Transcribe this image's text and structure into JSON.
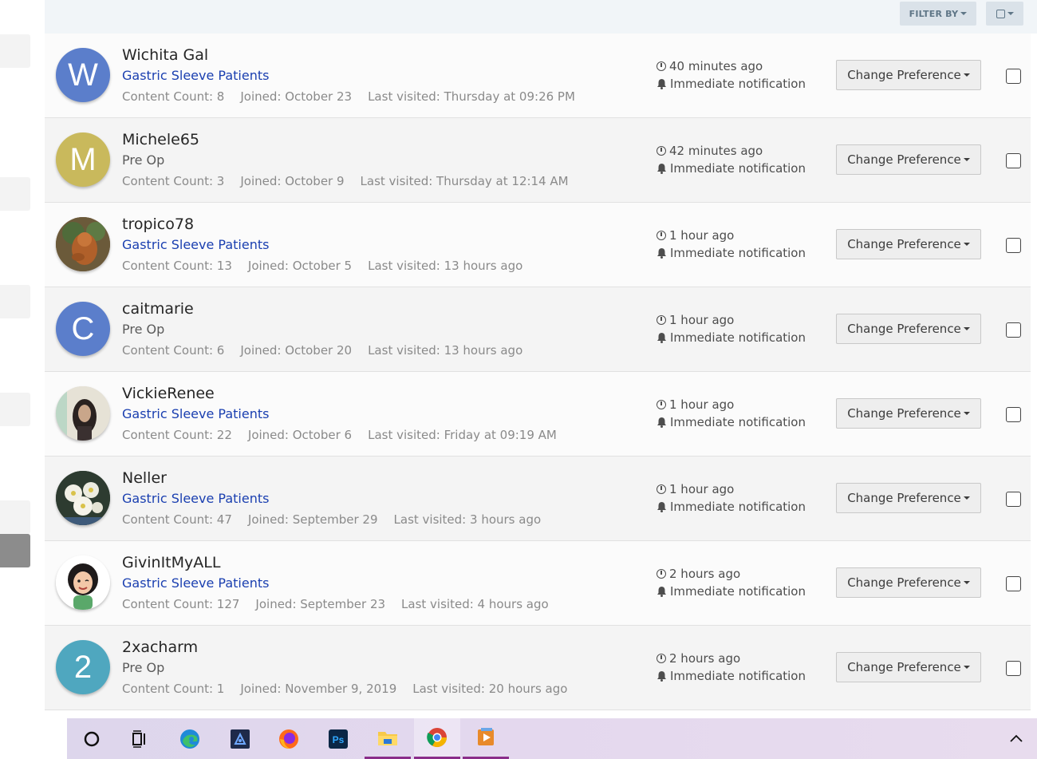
{
  "toolbar": {
    "filter_label": "FILTER BY"
  },
  "members": [
    {
      "name": "Wichita Gal",
      "group": "Gastric Sleeve Patients",
      "group_type": "link",
      "content_count": "Content Count: 8",
      "joined": "Joined: October 23",
      "last_visited": "Last visited: Thursday at 09:26 PM",
      "time": "40 minutes ago",
      "notification": "Immediate notification",
      "pref_label": "Change Preference",
      "avatar_letter": "W",
      "avatar_color": "#5b7ecb"
    },
    {
      "name": "Michele65",
      "group": "Pre Op",
      "group_type": "plain",
      "content_count": "Content Count: 3",
      "joined": "Joined: October 9",
      "last_visited": "Last visited: Thursday at 12:14 AM",
      "time": "42 minutes ago",
      "notification": "Immediate notification",
      "pref_label": "Change Preference",
      "avatar_letter": "M",
      "avatar_color": "#c9b95c"
    },
    {
      "name": "tropico78",
      "group": "Gastric Sleeve Patients",
      "group_type": "link",
      "content_count": "Content Count: 13",
      "joined": "Joined: October 5",
      "last_visited": "Last visited: 13 hours ago",
      "time": "1 hour ago",
      "notification": "Immediate notification",
      "pref_label": "Change Preference",
      "avatar_letter": "",
      "avatar_color": "#7a5a3a"
    },
    {
      "name": "caitmarie",
      "group": "Pre Op",
      "group_type": "plain",
      "content_count": "Content Count: 6",
      "joined": "Joined: October 20",
      "last_visited": "Last visited: 13 hours ago",
      "time": "1 hour ago",
      "notification": "Immediate notification",
      "pref_label": "Change Preference",
      "avatar_letter": "C",
      "avatar_color": "#5b7ecb"
    },
    {
      "name": "VickieRenee",
      "group": "Gastric Sleeve Patients",
      "group_type": "link",
      "content_count": "Content Count: 22",
      "joined": "Joined: October 6",
      "last_visited": "Last visited: Friday at 09:19 AM",
      "time": "1 hour ago",
      "notification": "Immediate notification",
      "pref_label": "Change Preference",
      "avatar_letter": "",
      "avatar_color": "#d9d4c8"
    },
    {
      "name": "Neller",
      "group": "Gastric Sleeve Patients",
      "group_type": "link",
      "content_count": "Content Count: 47",
      "joined": "Joined: September 29",
      "last_visited": "Last visited: 3 hours ago",
      "time": "1 hour ago",
      "notification": "Immediate notification",
      "pref_label": "Change Preference",
      "avatar_letter": "",
      "avatar_color": "#3c4a3c"
    },
    {
      "name": "GivinItMyALL",
      "group": "Gastric Sleeve Patients",
      "group_type": "link",
      "content_count": "Content Count: 127",
      "joined": "Joined: September 23",
      "last_visited": "Last visited: 4 hours ago",
      "time": "2 hours ago",
      "notification": "Immediate notification",
      "pref_label": "Change Preference",
      "avatar_letter": "",
      "avatar_color": "#ffffff"
    },
    {
      "name": "2xacharm",
      "group": "Pre Op",
      "group_type": "plain",
      "content_count": "Content Count: 1",
      "joined": "Joined: November 9, 2019",
      "last_visited": "Last visited: 20 hours ago",
      "time": "2 hours ago",
      "notification": "Immediate notification",
      "pref_label": "Change Preference",
      "avatar_letter": "2",
      "avatar_color": "#4fa7bf"
    }
  ],
  "taskbar": {
    "apps": [
      "search-circle",
      "task-view",
      "edge",
      "app-dark",
      "firefox",
      "photoshop",
      "file-explorer",
      "chrome",
      "media-app"
    ]
  }
}
